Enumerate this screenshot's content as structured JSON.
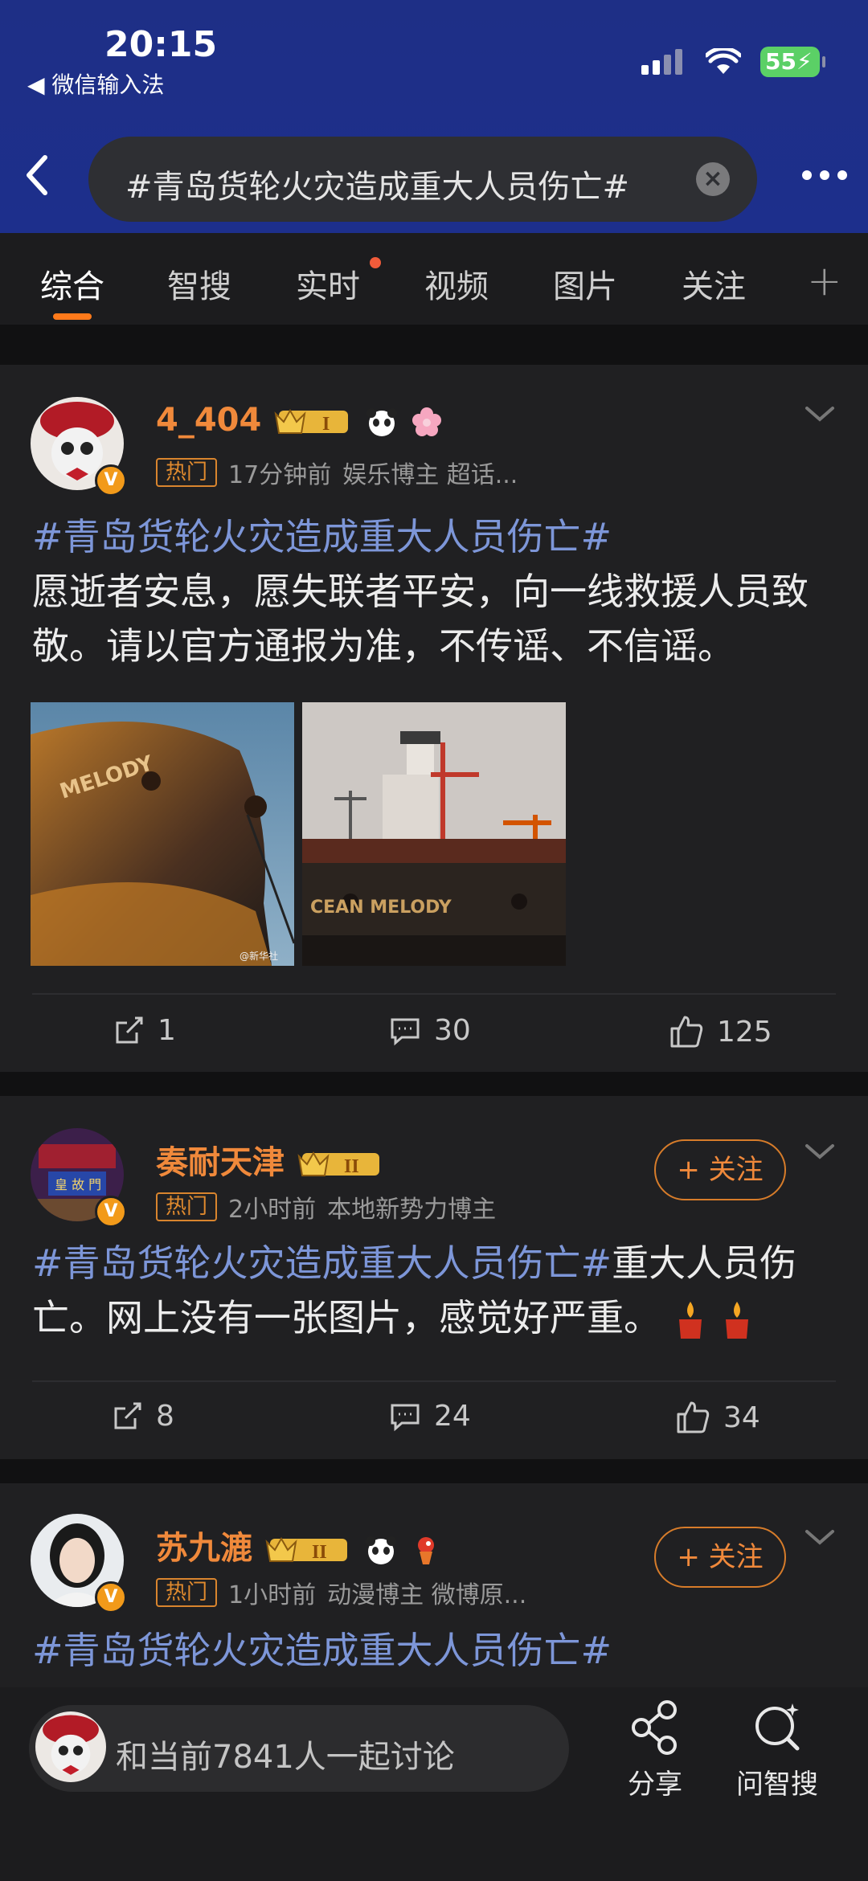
{
  "status_bar": {
    "time": "20:15",
    "back_app": "◀ 微信输入法",
    "battery": "55"
  },
  "search": {
    "query": "#青岛货轮火灾造成重大人员伤亡#",
    "clear": "×"
  },
  "tabs": [
    {
      "label": "综合"
    },
    {
      "label": "智搜"
    },
    {
      "label": "实时"
    },
    {
      "label": "视频"
    },
    {
      "label": "图片"
    },
    {
      "label": "关注"
    }
  ],
  "posts": [
    {
      "username": "4_404",
      "hot": "热门",
      "time": "17分钟前",
      "desc": "娱乐博主 超话...",
      "hashtag": "#青岛货轮火灾造成重大人员伤亡#",
      "body": "愿逝者安息，愿失联者平安，向一线救援人员致敬。请以官方通报为准，不传谣、不信谣。",
      "image_watermark": "@新华社",
      "ship_name_1": "MELODY",
      "ship_name_2": "CEAN MELODY",
      "shares": "1",
      "comments": "30",
      "likes": "125"
    },
    {
      "username": "奏耐天津",
      "hot": "热门",
      "time": "2小时前",
      "desc": "本地新势力博主",
      "follow": "+ 关注",
      "hashtag": "#青岛货轮火灾造成重大人员伤亡#",
      "body": "重大人员伤亡。网上没有一张图片，感觉好严重。",
      "shares": "8",
      "comments": "24",
      "likes": "34"
    },
    {
      "username": "苏九漉",
      "hot": "热门",
      "time": "1小时前",
      "desc": "动漫博主 微博原...",
      "follow": "+ 关注",
      "hashtag": "#青岛货轮火灾造成重大人员伤亡#"
    }
  ],
  "bottom_bar": {
    "discuss": "和当前7841人一起讨论",
    "share": "分享",
    "ask": "问智搜"
  },
  "colors": {
    "header_bg": "#1e2f86",
    "accent": "#f0893b",
    "hashtag": "#7d96d8",
    "card_bg": "#202022"
  }
}
